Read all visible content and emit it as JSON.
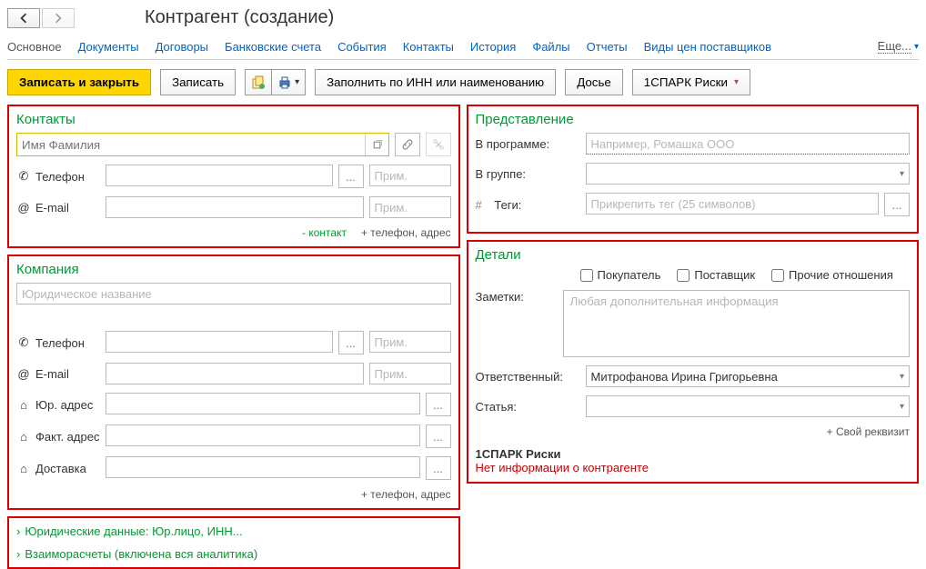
{
  "header": {
    "title": "Контрагент (создание)"
  },
  "tabs": {
    "main": "Основное",
    "docs": "Документы",
    "contracts": "Договоры",
    "bank": "Банковские счета",
    "events": "События",
    "contacts": "Контакты",
    "history": "История",
    "files": "Файлы",
    "reports": "Отчеты",
    "priceTypes": "Виды цен поставщиков",
    "more": "Еще..."
  },
  "toolbar": {
    "saveClose": "Записать и закрыть",
    "save": "Записать",
    "fillByInn": "Заполнить по ИНН или наименованию",
    "dossier": "Досье",
    "spark": "1СПАРК Риски"
  },
  "contacts": {
    "title": "Контакты",
    "namePlaceholder": "Имя Фамилия",
    "phoneLabel": "Телефон",
    "emailLabel": "E-mail",
    "notePlaceholder": "Прим.",
    "removeContact": "- контакт",
    "addPhoneAddr": "+ телефон, адрес"
  },
  "company": {
    "title": "Компания",
    "namePlaceholder": "Юридическое название",
    "phoneLabel": "Телефон",
    "emailLabel": "E-mail",
    "legalAddr": "Юр. адрес",
    "factAddr": "Факт. адрес",
    "delivery": "Доставка",
    "notePlaceholder": "Прим.",
    "addPhoneAddr": "+ телефон, адрес"
  },
  "exp": {
    "legal": "Юридические данные: Юр.лицо, ИНН...",
    "settle": "Взаиморасчеты (включена вся аналитика)"
  },
  "view": {
    "title": "Представление",
    "inProgram": "В программе:",
    "inProgramPh": "Например, Ромашка ООО",
    "inGroup": "В группе:",
    "tags": "Теги:",
    "tagsPh": "Прикрепить тег (25 символов)"
  },
  "details": {
    "title": "Детали",
    "buyer": "Покупатель",
    "supplier": "Поставщик",
    "other": "Прочие отношения",
    "notes": "Заметки:",
    "notesPh": "Любая дополнительная информация",
    "responsible": "Ответственный:",
    "responsibleVal": "Митрофанова Ирина Григорьевна",
    "article": "Статья:",
    "customAttr": "+ Свой реквизит",
    "sparkHdr": "1СПАРК Риски",
    "noInfo": "Нет информации о контрагенте"
  }
}
